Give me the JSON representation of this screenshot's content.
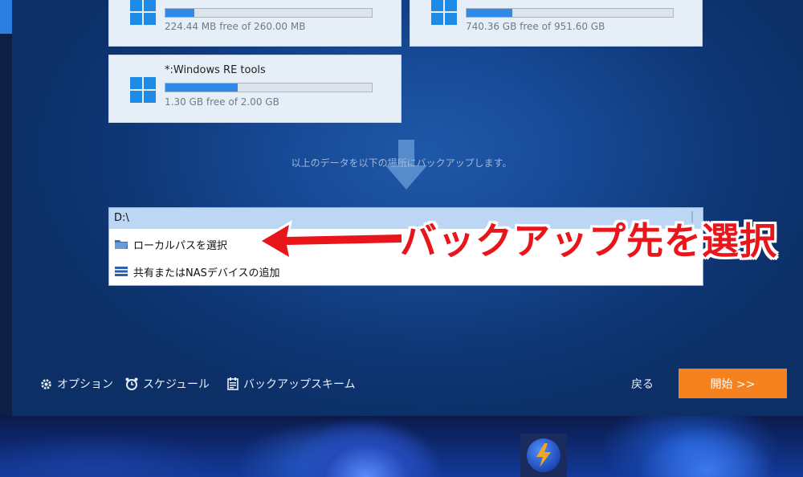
{
  "drives": [
    {
      "name": "",
      "free_text": "224.44 MB free of 260.00 MB",
      "used_fraction": 0.14
    },
    {
      "name": "",
      "free_text": "740.36 GB free of 951.60 GB",
      "used_fraction": 0.22
    },
    {
      "name": "*:Windows RE tools",
      "free_text": "1.30 GB free of 2.00 GB",
      "used_fraction": 0.35
    }
  ],
  "info_text": "以上のデータを以下の場所にバックアップします。",
  "destination": {
    "path": "D:\\",
    "options": [
      {
        "label": "ローカルパスを選択",
        "icon": "folder-icon"
      },
      {
        "label": "共有またはNASデバイスの追加",
        "icon": "nas-icon"
      }
    ]
  },
  "annotation": "バックアップ先を選択",
  "bottom": {
    "options_label": "オプション",
    "schedule_label": "スケジュール",
    "scheme_label": "バックアップスキーム",
    "back_label": "戻る",
    "start_label": "開始 >>"
  },
  "colors": {
    "accent_orange": "#f6821f",
    "progress_blue": "#2e8ae6",
    "annotation_red": "#e8161b"
  }
}
